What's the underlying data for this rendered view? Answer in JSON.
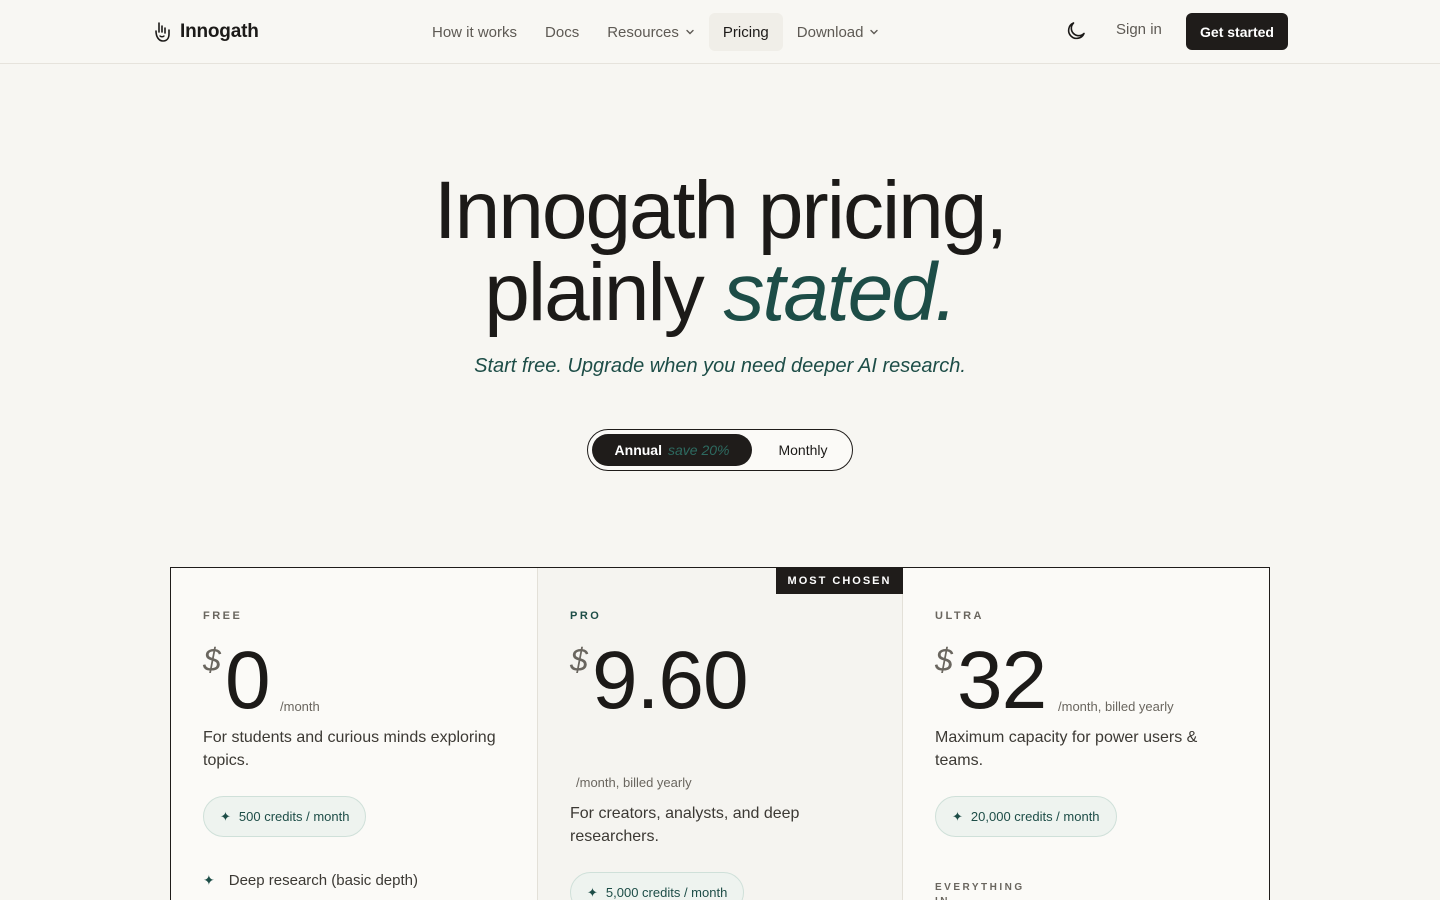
{
  "nav": {
    "brand": "Innogath",
    "links": [
      {
        "label": "How it works",
        "dropdown": false,
        "active": false
      },
      {
        "label": "Docs",
        "dropdown": false,
        "active": false
      },
      {
        "label": "Resources",
        "dropdown": true,
        "active": false
      },
      {
        "label": "Pricing",
        "dropdown": false,
        "active": true
      },
      {
        "label": "Download",
        "dropdown": true,
        "active": false
      }
    ],
    "sign_in": "Sign in",
    "get_started": "Get started"
  },
  "hero": {
    "title_line1": "Innogath pricing,",
    "title_line2_plain": "plainly ",
    "title_line2_accent": "stated.",
    "subtitle": "Start free. Upgrade when you need deeper AI research."
  },
  "billing_toggle": {
    "annual_label": "Annual",
    "annual_save": "save 20%",
    "monthly_label": "Monthly",
    "selected": "annual"
  },
  "plans": [
    {
      "tier": "FREE",
      "currency": "$",
      "amount": "0",
      "period": "/month",
      "description": "For students and curious minds exploring topics.",
      "credits": "500 credits / month",
      "features": [
        "Deep research (basic depth)"
      ]
    },
    {
      "tier": "PRO",
      "badge": "MOST CHOSEN",
      "currency": "$",
      "amount": "9.60",
      "period": "/month, billed yearly",
      "description": "For creators, analysts, and deep researchers.",
      "credits": "5,000 credits / month"
    },
    {
      "tier": "ULTRA",
      "currency": "$",
      "amount": "32",
      "period": "/month, billed yearly",
      "description": "Maximum capacity for power users & teams.",
      "credits": "20,000 credits / month",
      "section_label": "EVERYTHING IN"
    }
  ],
  "colors": {
    "accent": "#1d4d47",
    "dark": "#1f1c1a",
    "background": "#f7f6f2"
  }
}
